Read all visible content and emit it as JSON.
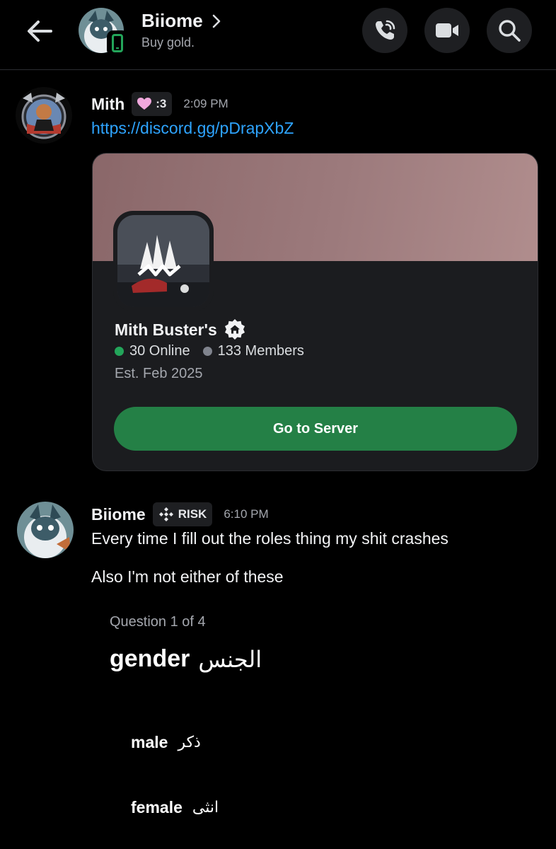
{
  "header": {
    "title": "Biiome",
    "status": "Buy gold.",
    "icons": {
      "back": "arrow-left-icon",
      "chevron": "chevron-right-icon",
      "call": "phone-call-icon",
      "video": "video-camera-icon",
      "search": "search-icon",
      "mobile": "mobile-phone-icon"
    }
  },
  "messages": [
    {
      "author": "Mith",
      "tag": ":3",
      "tag_icon": "heart-icon",
      "time": "2:09 PM",
      "link": "https://discord.gg/pDrapXbZ",
      "invite": {
        "server_name": "Mith Buster's",
        "online": "30 Online",
        "members": "133 Members",
        "established": "Est. Feb 2025",
        "button_label": "Go to Server",
        "badge_icon": "community-home-icon"
      }
    },
    {
      "author": "Biiome",
      "tag": "RISK",
      "tag_icon": "diamond-cluster-icon",
      "time": "6:10 PM",
      "lines": [
        "Every time I fill out the roles thing my shit crashes",
        "Also I'm not either of these"
      ],
      "question": {
        "progress": "Question 1 of 4",
        "title": "gender",
        "title_ar": "الجنس",
        "options": [
          {
            "label": "male",
            "label_ar": "ذكر"
          },
          {
            "label": "female",
            "label_ar": "انثى"
          }
        ]
      }
    }
  ],
  "colors": {
    "background": "#000000",
    "link": "#2ea4ff",
    "online": "#23a55a",
    "button": "#248046",
    "banner": "#9c7a7c"
  }
}
